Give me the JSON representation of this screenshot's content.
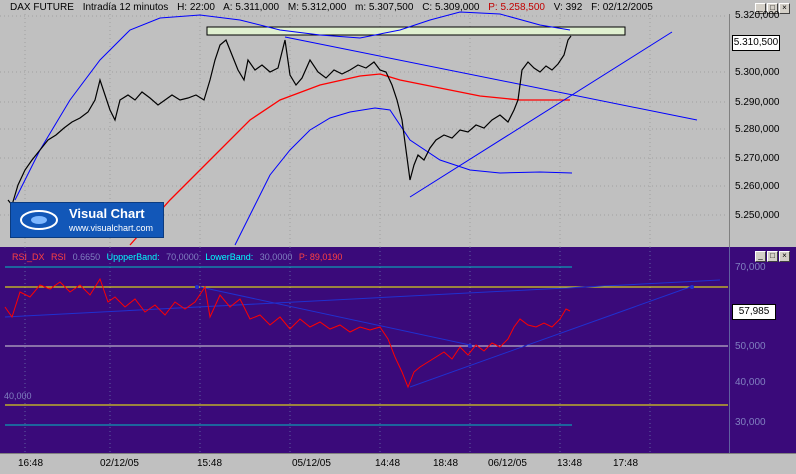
{
  "header": {
    "instrument": "DAX FUTURE",
    "interval": "Intradía 12 minutos",
    "high": "H: 22:00",
    "a": "A: 5.311,000",
    "max": "M: 5.312,000",
    "min": "m: 5.307,500",
    "close": "C: 5.309,000",
    "p": "P: 5.258,500",
    "volume": "V: 392",
    "date": "F: 02/12/2005"
  },
  "price_axis": {
    "ticks": [
      "5.320,000",
      "5.310,500",
      "5.300,000",
      "5.290,000",
      "5.280,000",
      "5.270,000",
      "5.260,000",
      "5.250,000"
    ],
    "current_price": "5.310,500"
  },
  "logo": {
    "title": "Visual Chart",
    "url": "www.visualchart.com"
  },
  "rsi": {
    "label": "RSI_DX",
    "rsi_label": "RSI",
    "rsi_value": "0.6650",
    "upper_label": "UppperBand:",
    "upper_value": "70,0000",
    "lower_label": "LowerBand:",
    "lower_value": "30,0000",
    "p_label": "P: 89,0190",
    "ticks": [
      "70,000",
      "50,000",
      "40,000",
      "30,000"
    ],
    "current": "57,985",
    "left_label": "40,000"
  },
  "time_axis": [
    "16:48",
    "02/12/05",
    "15:48",
    "05/12/05",
    "14:48",
    "18:48",
    "06/12/05",
    "13:48",
    "17:48"
  ],
  "colors": {
    "top_bg": "#c0c0c0",
    "rsi_bg": "#3a0a7a",
    "price_series": "#000000",
    "bollinger": "#0000ff",
    "ma": "#ff0000",
    "rsi_line": "#ff0000",
    "band_yellow": "#ffff00",
    "band_cyan": "#00c0c0",
    "band_white": "#d8d8d8"
  }
}
